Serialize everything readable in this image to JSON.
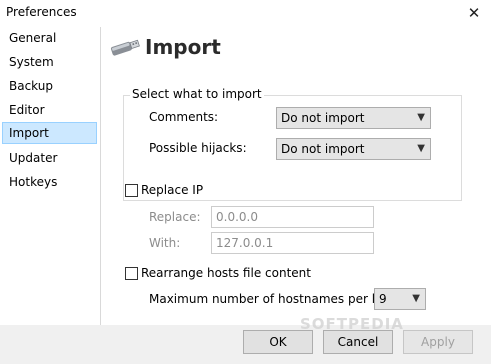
{
  "window": {
    "title": "Preferences"
  },
  "sidebar": {
    "items": [
      {
        "label": "General"
      },
      {
        "label": "System"
      },
      {
        "label": "Backup"
      },
      {
        "label": "Editor"
      },
      {
        "label": "Import",
        "selected": true
      },
      {
        "label": "Updater"
      },
      {
        "label": "Hotkeys"
      }
    ]
  },
  "header": {
    "title": "Import",
    "icon": "usb-drive-icon"
  },
  "import_group": {
    "legend": "Select what to import",
    "comments": {
      "label": "Comments:",
      "value": "Do not import"
    },
    "hijacks": {
      "label": "Possible hijacks:",
      "value": "Do not import"
    }
  },
  "replace_ip": {
    "label": "Replace IP",
    "checked": false,
    "replace_label": "Replace:",
    "replace_value": "0.0.0.0",
    "with_label": "With:",
    "with_value": "127.0.0.1"
  },
  "rearrange": {
    "label": "Rearrange hosts file content",
    "checked": false,
    "max_label": "Maximum number of hostnames per line:",
    "max_value": "9"
  },
  "buttons": {
    "ok": "OK",
    "cancel": "Cancel",
    "apply": "Apply"
  },
  "watermark": "SOFTPEDIA"
}
